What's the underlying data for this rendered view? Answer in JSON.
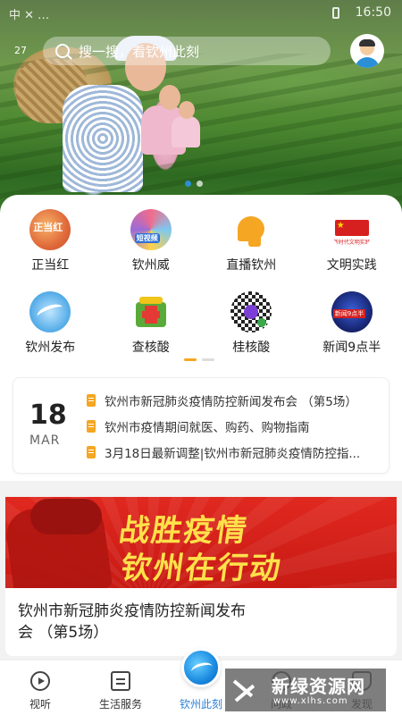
{
  "status_bar": {
    "left": "中  ✕  …",
    "time": "16:50"
  },
  "hero": {
    "side_number": "27",
    "slide_count": 2,
    "active_slide": 0
  },
  "search": {
    "placeholder": "搜一搜，看钦州此刻"
  },
  "quick_links": [
    {
      "label": "正当红",
      "icon": "zhengdanghong-icon",
      "icon_text": "正当红"
    },
    {
      "label": "钦州威",
      "icon": "qinzhouwei-icon",
      "icon_text": "短视频"
    },
    {
      "label": "直播钦州",
      "icon": "live-shell-icon"
    },
    {
      "label": "文明实践",
      "icon": "civilization-flag-icon",
      "icon_text": "新时代文明实践"
    },
    {
      "label": "钦州发布",
      "icon": "qinzhou-release-icon"
    },
    {
      "label": "查核酸",
      "icon": "medical-kit-icon"
    },
    {
      "label": "桂核酸",
      "icon": "qr-code-icon"
    },
    {
      "label": "新闻9点半",
      "icon": "news-930-icon",
      "icon_text": "新闻9点半"
    }
  ],
  "grid_pages": {
    "count": 2,
    "active": 0
  },
  "news_box": {
    "day": "18",
    "month": "MAR",
    "items": [
      "钦州市新冠肺炎疫情防控新闻发布会 （第5场）",
      "钦州市疫情期间就医、购药、购物指南",
      "3月18日最新调整|钦州市新冠肺炎疫情防控指..."
    ]
  },
  "banner": {
    "line1": "战胜疫情",
    "line2": "钦州在行动"
  },
  "article": {
    "title": "钦州市新冠肺炎疫情防控新闻发布会 （第5场）"
  },
  "tabs": [
    {
      "label": "视听",
      "icon": "play-icon",
      "active": false
    },
    {
      "label": "生活服务",
      "icon": "life-service-icon",
      "active": false
    },
    {
      "label": "钦州此刻",
      "icon": "qinzhou-now-icon",
      "active": true
    },
    {
      "label": "问政",
      "icon": "government-icon",
      "active": false
    },
    {
      "label": "发现",
      "icon": "discover-icon",
      "active": false
    }
  ],
  "watermark": {
    "title": "新绿资源网",
    "url": "www.xlhs.com"
  },
  "colors": {
    "accent": "#2b7fd6",
    "banner_red": "#d8231b",
    "banner_text": "#ffe14a",
    "doc_icon": "#f5a623"
  }
}
